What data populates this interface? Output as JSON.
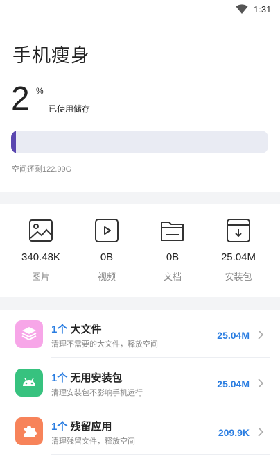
{
  "status_bar": {
    "time": "1:31"
  },
  "page_title": "手机瘦身",
  "usage": {
    "percent": "2",
    "unit": "%",
    "label": "已使用储存",
    "fill_fraction": 0.02
  },
  "remaining": "空间还剩122.99G",
  "categories": [
    {
      "size": "340.48K",
      "label": "图片",
      "icon": "image-icon"
    },
    {
      "size": "0B",
      "label": "视频",
      "icon": "video-icon"
    },
    {
      "size": "0B",
      "label": "文档",
      "icon": "folder-icon"
    },
    {
      "size": "25.04M",
      "label": "安装包",
      "icon": "package-download-icon"
    }
  ],
  "items": [
    {
      "count": "1个",
      "title": "大文件",
      "subtitle": "清理不需要的大文件，释放空间",
      "size": "25.04M",
      "icon": "layers-icon",
      "color": "#f7a6e8"
    },
    {
      "count": "1个",
      "title": "无用安装包",
      "subtitle": "清理安装包不影响手机运行",
      "size": "25.04M",
      "icon": "android-icon",
      "color": "#37c27f"
    },
    {
      "count": "1个",
      "title": "残留应用",
      "subtitle": "清理残留文件，释放空间",
      "size": "209.9K",
      "icon": "puzzle-icon",
      "color": "#f7835a"
    }
  ]
}
